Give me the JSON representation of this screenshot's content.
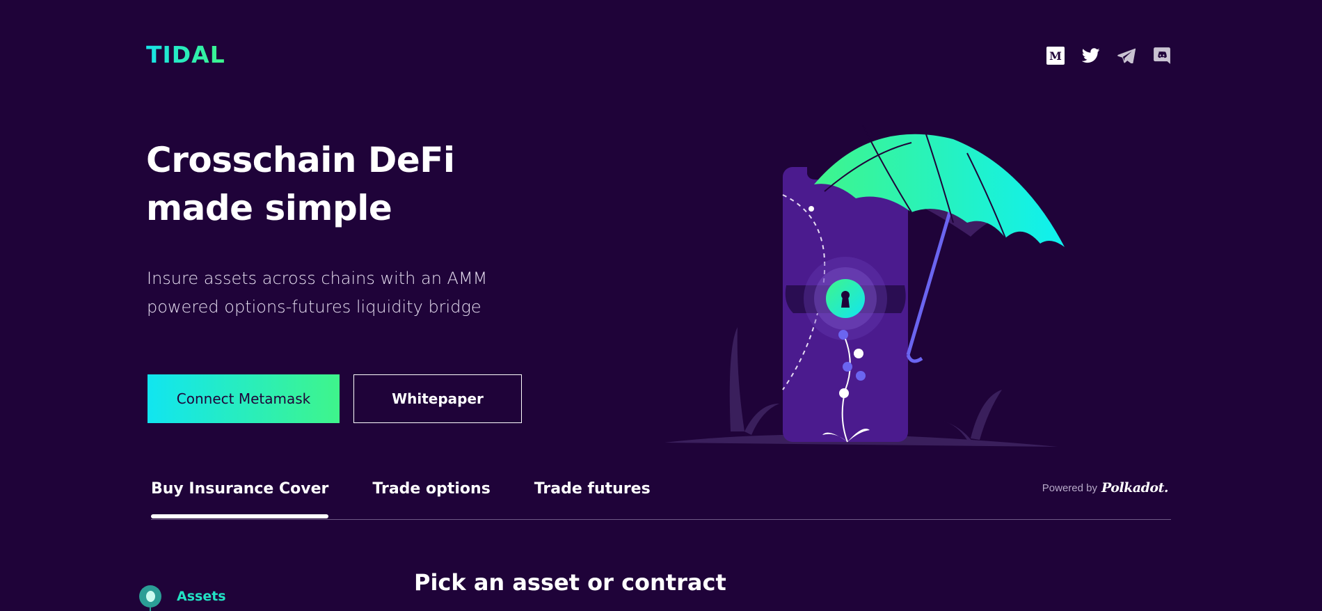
{
  "header": {
    "logo": "TIDAL",
    "social": [
      {
        "icon": "medium-icon"
      },
      {
        "icon": "twitter-icon"
      },
      {
        "icon": "telegram-icon"
      },
      {
        "icon": "discord-icon"
      }
    ]
  },
  "hero": {
    "title_line1": "Crosschain DeFi",
    "title_line2": "made simple",
    "subtitle_line1": "Insure assets across chains with an AMM",
    "subtitle_line2": "powered options-futures liquidity bridge",
    "primary_button": "Connect Metamask",
    "secondary_button": "Whitepaper"
  },
  "tabs": [
    {
      "label": "Buy Insurance Cover",
      "active": true
    },
    {
      "label": "Trade options",
      "active": false
    },
    {
      "label": "Trade futures",
      "active": false
    }
  ],
  "powered": {
    "label": "Powered by",
    "brand": "Polkadot."
  },
  "steps": {
    "first_label": "Assets"
  },
  "section": {
    "title": "Pick an asset or contract"
  },
  "colors": {
    "background": "#1f0339",
    "accent_cyan": "#11e5f0",
    "accent_green": "#3ff58b",
    "step_teal": "#22e3c5"
  }
}
